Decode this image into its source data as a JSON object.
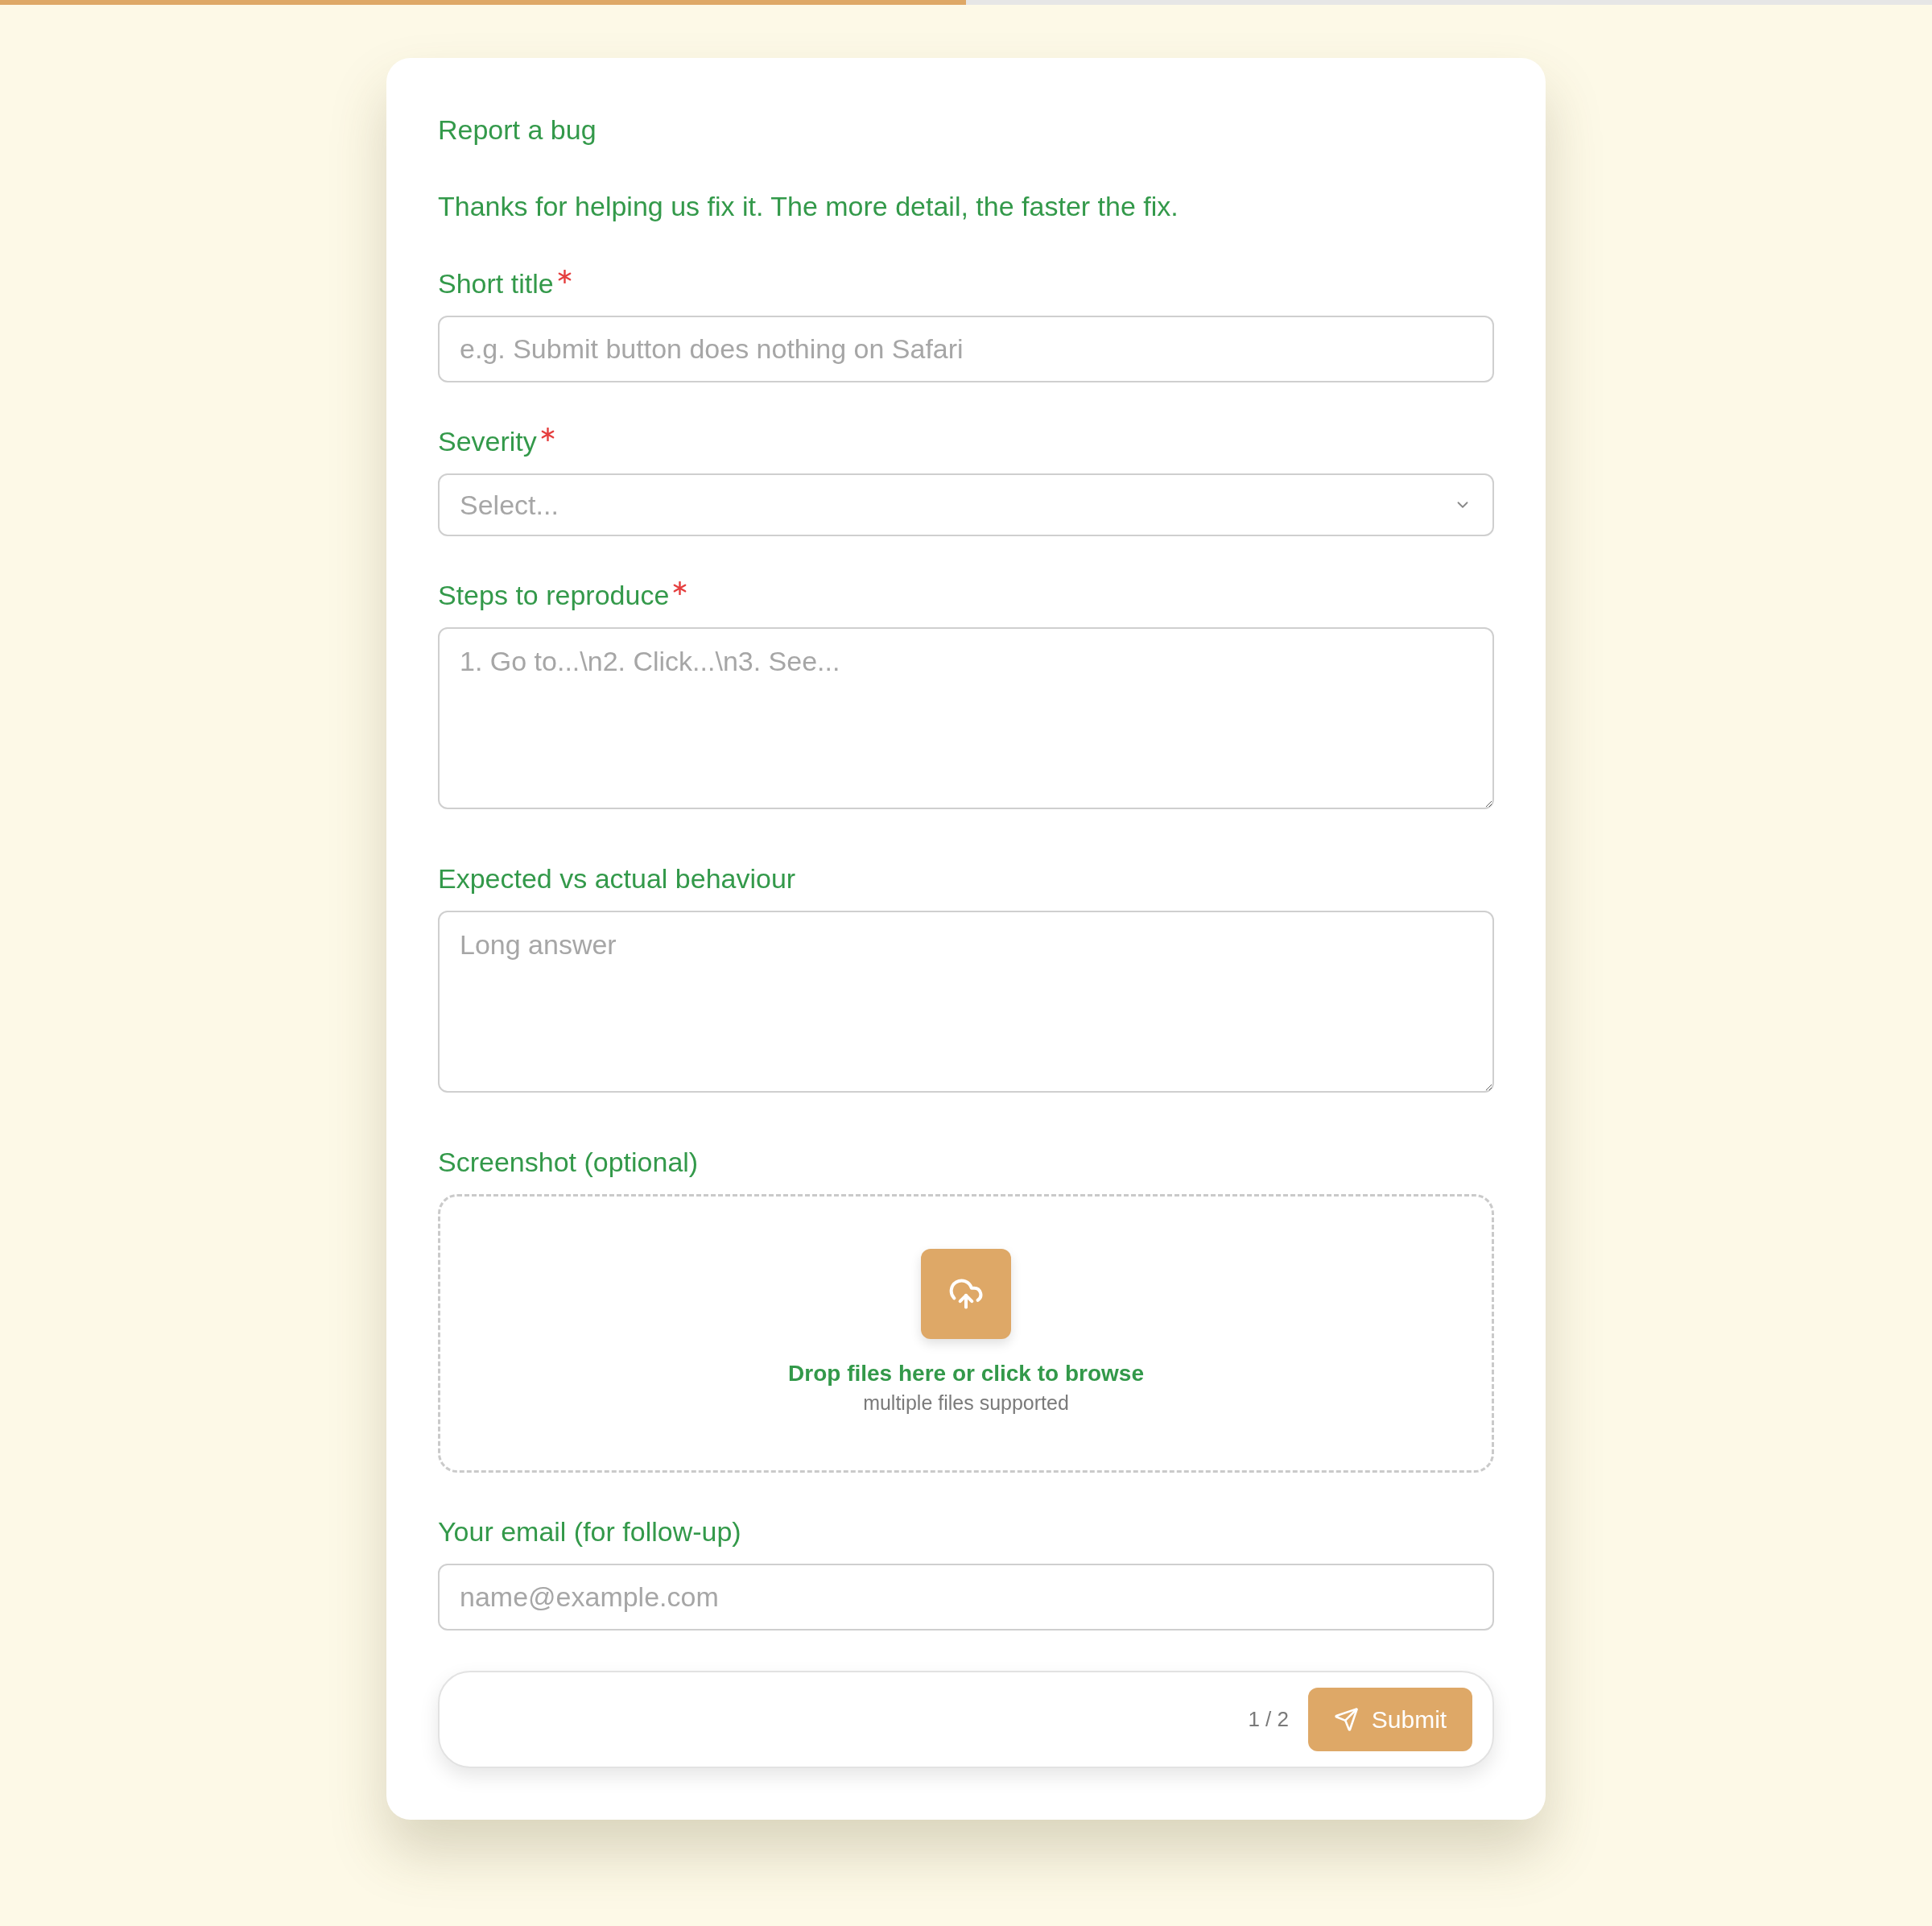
{
  "progress": {
    "level": 0.5
  },
  "form": {
    "title": "Report a bug",
    "description": "Thanks for helping us fix it. The more detail, the faster the fix.",
    "fields": [
      {
        "kind": "text",
        "label": "Short title",
        "required": true,
        "placeholder": "e.g. Submit button does nothing on Safari"
      },
      {
        "kind": "select",
        "label": "Severity",
        "required": true,
        "placeholder": "Select..."
      },
      {
        "kind": "textarea",
        "label": "Steps to reproduce",
        "required": true,
        "placeholder": "1. Go to...\\n2. Click...\\n3. See..."
      },
      {
        "kind": "textarea",
        "label": "Expected vs actual behaviour",
        "required": false,
        "placeholder": "Long answer"
      },
      {
        "kind": "upload",
        "label": "Screenshot (optional)",
        "required": false,
        "prompt": "Drop files here or click to browse",
        "hint": "multiple files supported"
      },
      {
        "kind": "email",
        "label": "Your email (for follow-up)",
        "required": false,
        "placeholder": "name@example.com"
      }
    ]
  },
  "footer": {
    "page": "1 / 2",
    "submit": "Submit"
  }
}
